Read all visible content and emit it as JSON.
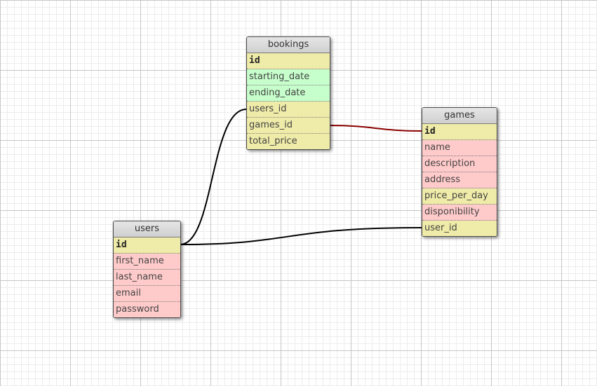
{
  "colors": {
    "key_field": "#efeba8",
    "text_field": "#ffcaca",
    "date_field": "#c7ffcc",
    "relation_default": "#000000",
    "relation_selected": "#8b0000"
  },
  "tables": {
    "bookings": {
      "title": "bookings",
      "fields": [
        {
          "name": "id",
          "kind": "key"
        },
        {
          "name": "starting_date",
          "kind": "date"
        },
        {
          "name": "ending_date",
          "kind": "date"
        },
        {
          "name": "users_id",
          "kind": "key"
        },
        {
          "name": "games_id",
          "kind": "key"
        },
        {
          "name": "total_price",
          "kind": "key"
        }
      ]
    },
    "games": {
      "title": "games",
      "fields": [
        {
          "name": "id",
          "kind": "key"
        },
        {
          "name": "name",
          "kind": "text"
        },
        {
          "name": "description",
          "kind": "text"
        },
        {
          "name": "address",
          "kind": "text"
        },
        {
          "name": "price_per_day",
          "kind": "key"
        },
        {
          "name": "disponibility",
          "kind": "text"
        },
        {
          "name": "user_id",
          "kind": "key"
        }
      ]
    },
    "users": {
      "title": "users",
      "fields": [
        {
          "name": "id",
          "kind": "key"
        },
        {
          "name": "first_name",
          "kind": "text"
        },
        {
          "name": "last_name",
          "kind": "text"
        },
        {
          "name": "email",
          "kind": "text"
        },
        {
          "name": "password",
          "kind": "text"
        }
      ]
    }
  }
}
